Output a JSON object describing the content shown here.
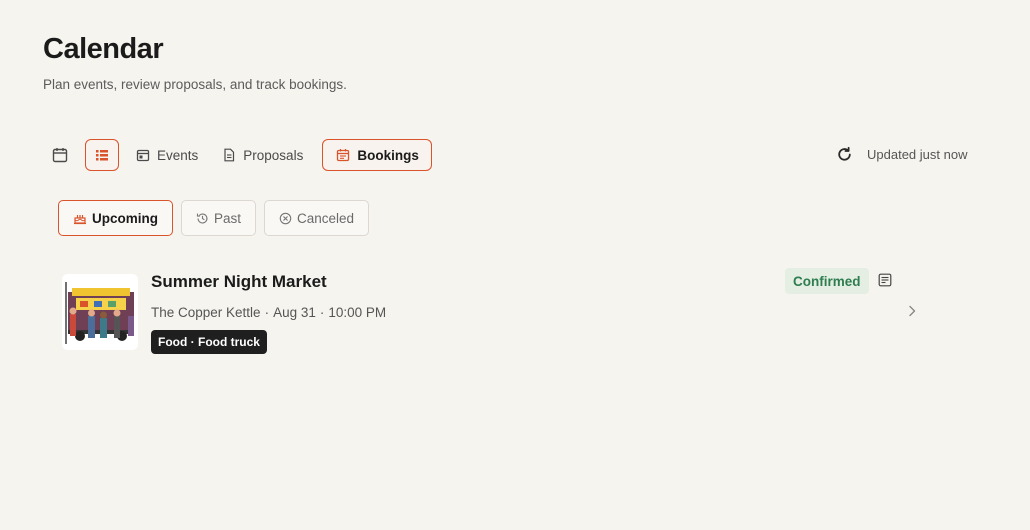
{
  "page": {
    "title": "Calendar",
    "subtitle": "Plan events, review proposals, and track bookings."
  },
  "view_tabs": {
    "calendar_icon": "calendar-icon",
    "list_icon": "list-icon",
    "events": "Events",
    "proposals": "Proposals",
    "bookings": "Bookings",
    "active": "bookings"
  },
  "refresh": {
    "icon": "refresh-icon",
    "status": "Updated just now"
  },
  "filters": {
    "upcoming": "Upcoming",
    "past": "Past",
    "canceled": "Canceled",
    "active": "upcoming"
  },
  "bookings": [
    {
      "title": "Summer Night Market",
      "venue": "The Copper Kettle",
      "date": "Aug 31",
      "time": "10:00 PM",
      "tag": "Food · Food truck",
      "status": "Confirmed"
    }
  ],
  "colors": {
    "accent": "#d9532b",
    "background": "#f6f4ef",
    "status_bg": "#e4eee3",
    "status_text": "#2e7d4f",
    "tag_bg": "#1f1f1f"
  }
}
